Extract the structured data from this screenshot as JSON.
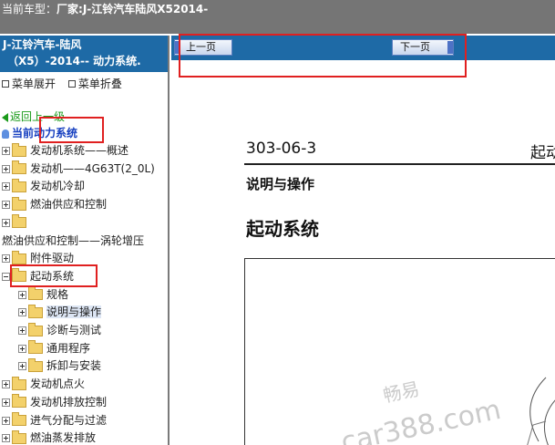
{
  "header": {
    "label": "当前车型：",
    "value": "厂家:J-江铃汽车陆风X52014-"
  },
  "sidebar": {
    "title_line1": "J-江铃汽车-陆风",
    "title_line2": "（X5）-2014-- 动力系统.",
    "expand_label": "菜单展开",
    "collapse_label": "菜单折叠",
    "back_label": "返回上一级",
    "current_label": "当前",
    "current_value": "动力系统",
    "tree": [
      {
        "label": "发动机系统——概述",
        "level": 0,
        "expanded": false
      },
      {
        "label": "发动机——4G63T(2_0L)",
        "level": 0,
        "expanded": false
      },
      {
        "label": "发动机冷却",
        "level": 0,
        "expanded": false
      },
      {
        "label": "燃油供应和控制",
        "level": 0,
        "expanded": false
      },
      {
        "label": "",
        "level": 0,
        "expanded": false
      },
      {
        "label": "燃油供应和控制——涡轮增压",
        "level": -1,
        "expanded": false
      },
      {
        "label": "附件驱动",
        "level": 0,
        "expanded": false
      },
      {
        "label": "起动系统",
        "level": 0,
        "expanded": true
      },
      {
        "label": "规格",
        "level": 1,
        "expanded": false
      },
      {
        "label": "说明与操作",
        "level": 1,
        "expanded": false,
        "selected": true
      },
      {
        "label": "诊断与测试",
        "level": 1,
        "expanded": false
      },
      {
        "label": "通用程序",
        "level": 1,
        "expanded": false
      },
      {
        "label": "拆卸与安装",
        "level": 1,
        "expanded": false
      },
      {
        "label": "发动机点火",
        "level": 0,
        "expanded": false
      },
      {
        "label": "发动机排放控制",
        "level": 0,
        "expanded": false
      },
      {
        "label": "进气分配与过滤",
        "level": 0,
        "expanded": false
      },
      {
        "label": "燃油蒸发排放",
        "level": 0,
        "expanded": false
      }
    ]
  },
  "content": {
    "prev_label": "上一页",
    "next_label": "下一页",
    "doc_number": "303-06-3",
    "doc_tail": "起动",
    "subtitle": "说明与操作",
    "title": "起动系统",
    "watermark_top": "畅易",
    "watermark_bottom": "car388.com"
  },
  "colors": {
    "header_bg": "#757575",
    "panel_blue": "#1e6aa6",
    "highlight_red": "#e02020",
    "back_green": "#1a9a1a"
  }
}
